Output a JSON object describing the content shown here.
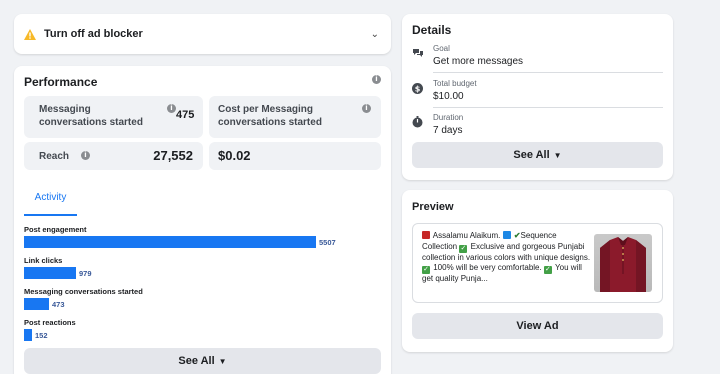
{
  "adblock": {
    "label": "Turn off ad blocker"
  },
  "performance": {
    "title": "Performance",
    "metrics": [
      {
        "label": "Messaging conversations started",
        "value": "475"
      },
      {
        "label": "Cost per Messaging conversations started",
        "value": ""
      },
      {
        "label": "Reach",
        "value": "27,552"
      },
      {
        "label": "",
        "value": "$0.02"
      }
    ],
    "tab": "Activity",
    "activity": [
      {
        "label": "Post engagement",
        "value": "5507",
        "amount": 5507
      },
      {
        "label": "Link clicks",
        "value": "979",
        "amount": 979
      },
      {
        "label": "Messaging conversations started",
        "value": "473",
        "amount": 473
      },
      {
        "label": "Post reactions",
        "value": "152",
        "amount": 152
      }
    ],
    "see_all": "See All"
  },
  "details": {
    "title": "Details",
    "rows": [
      {
        "key": "Goal",
        "value": "Get more messages",
        "icon": "chat-bubbles-icon"
      },
      {
        "key": "Total budget",
        "value": "$10.00",
        "icon": "dollar-icon"
      },
      {
        "key": "Duration",
        "value": "7 days",
        "icon": "stopwatch-icon"
      }
    ],
    "see_all": "See All"
  },
  "preview": {
    "title": "Preview",
    "text_1": "Assalamu Alaikum.",
    "text_2": "Sequence Collection",
    "text_3": "Exclusive and gorgeous Punjabi collection in various colors with unique designs.",
    "text_4": "100% will be very comfortable.",
    "text_5": "You will get quality Punja...",
    "view_ad": "View Ad"
  },
  "colors": {
    "accent": "#1877f2",
    "warning": "#f7b928",
    "product": "#8b1a2b"
  }
}
